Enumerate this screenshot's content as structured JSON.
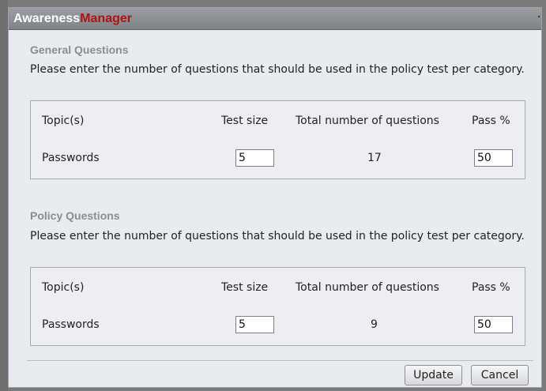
{
  "title": {
    "part1": "Awareness",
    "part2": "Manager"
  },
  "sections": [
    {
      "title": "General Questions",
      "description": "Please enter the number of questions that should be used in the policy test per category.",
      "headers": {
        "topic": "Topic(s)",
        "test_size": "Test size",
        "total": "Total number of questions",
        "pass": "Pass %"
      },
      "row": {
        "topic": "Passwords",
        "test_size": "5",
        "total": "17",
        "pass": "50"
      }
    },
    {
      "title": "Policy Questions",
      "description": "Please enter the number of questions that should be used in the policy test per category.",
      "headers": {
        "topic": "Topic(s)",
        "test_size": "Test size",
        "total": "Total number of questions",
        "pass": "Pass %"
      },
      "row": {
        "topic": "Passwords",
        "test_size": "5",
        "total": "9",
        "pass": "50"
      }
    }
  ],
  "buttons": {
    "update": "Update",
    "cancel": "Cancel"
  }
}
